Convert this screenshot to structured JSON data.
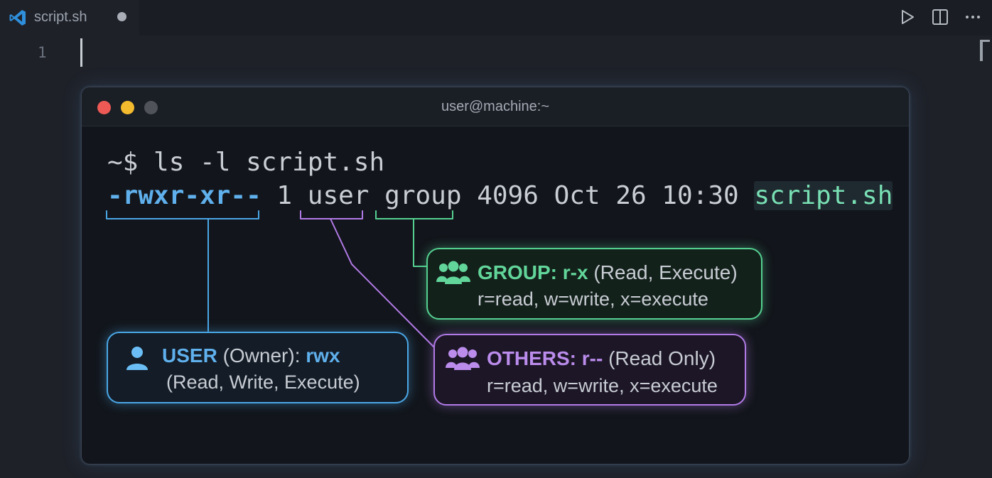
{
  "editor_tab": {
    "title": "script.sh",
    "icon": "vscode-icon"
  },
  "editor": {
    "line_numbers": [
      "1"
    ]
  },
  "actions": {
    "run": "play-icon",
    "split": "split-editor-icon",
    "more": "ellipsis-icon"
  },
  "terminal": {
    "title": "user@machine:~",
    "prompt": "~$",
    "command": " ls -l script.sh",
    "output": {
      "permissions": "-rwxr-xr--",
      "links": " 1 ",
      "owner": "user",
      "group": " group",
      "size_date": " 4096 Oct 26 10:30 ",
      "filename": "script.sh"
    }
  },
  "callouts": {
    "user": {
      "label": "USER",
      "role": " (Owner): ",
      "perms": "rwx",
      "detail": "(Read, Write, Execute)"
    },
    "group": {
      "label": "GROUP: ",
      "perms": "r-x",
      "detail_inline": " (Read, Execute)",
      "legend": "r=read, w=write, x=execute"
    },
    "others": {
      "label": "OTHERS: ",
      "perms": "r--",
      "detail_inline": " (Read Only)",
      "legend": "r=read, w=write, x=execute"
    }
  },
  "colors": {
    "user": "#4aa7e6",
    "group": "#55d091",
    "others": "#b17ae6",
    "window_close": "#ed5a55",
    "window_minimize": "#f3bb2d",
    "window_zoom": "#50535a"
  }
}
